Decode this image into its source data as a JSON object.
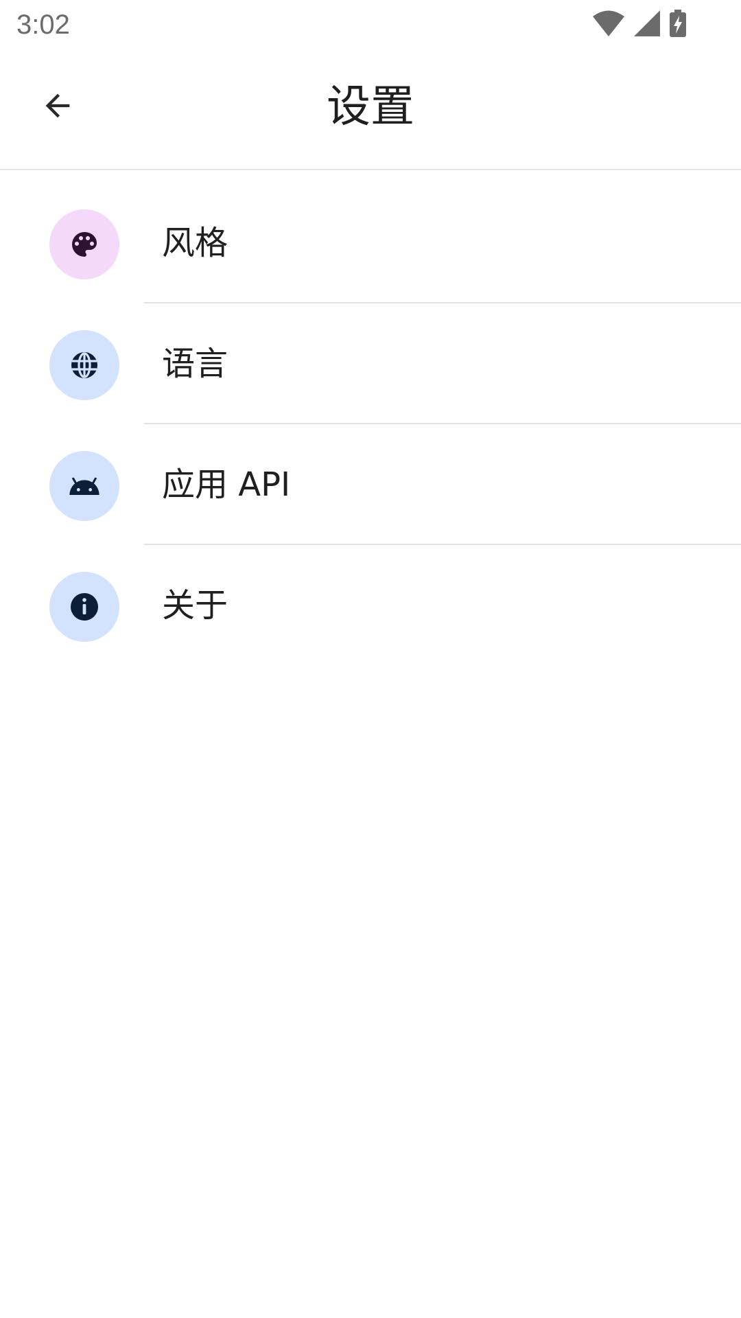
{
  "status_bar": {
    "time": "3:02",
    "icons": [
      "wifi-icon",
      "signal-icon",
      "battery-charging-icon"
    ]
  },
  "app_bar": {
    "back_icon": "arrow-back-icon",
    "title": "设置"
  },
  "settings": {
    "items": [
      {
        "label": "风格",
        "icon": "palette-icon",
        "icon_bg": "#f5d9fb",
        "icon_fg": "#2e1233"
      },
      {
        "label": "语言",
        "icon": "globe-icon",
        "icon_bg": "#d3e3fd",
        "icon_fg": "#0b1f3a"
      },
      {
        "label": "应用 API",
        "icon": "android-icon",
        "icon_bg": "#d3e3fd",
        "icon_fg": "#0b1f3a"
      },
      {
        "label": "关于",
        "icon": "info-icon",
        "icon_bg": "#d3e3fd",
        "icon_fg": "#0b1f3a"
      }
    ]
  }
}
